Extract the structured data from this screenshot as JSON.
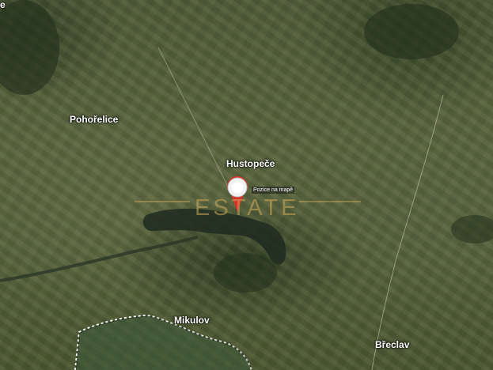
{
  "map": {
    "type": "satellite",
    "places": {
      "pohorelice": "Pohořelice",
      "hustopece": "Hustopeče",
      "mikulov": "Mikulov",
      "breclav": "Břeclav",
      "corner": "e"
    },
    "marker": {
      "icon": "map-pin-icon",
      "label": "Pozice na mapě",
      "color": "#d9322a"
    },
    "watermark": "ESTATE"
  }
}
